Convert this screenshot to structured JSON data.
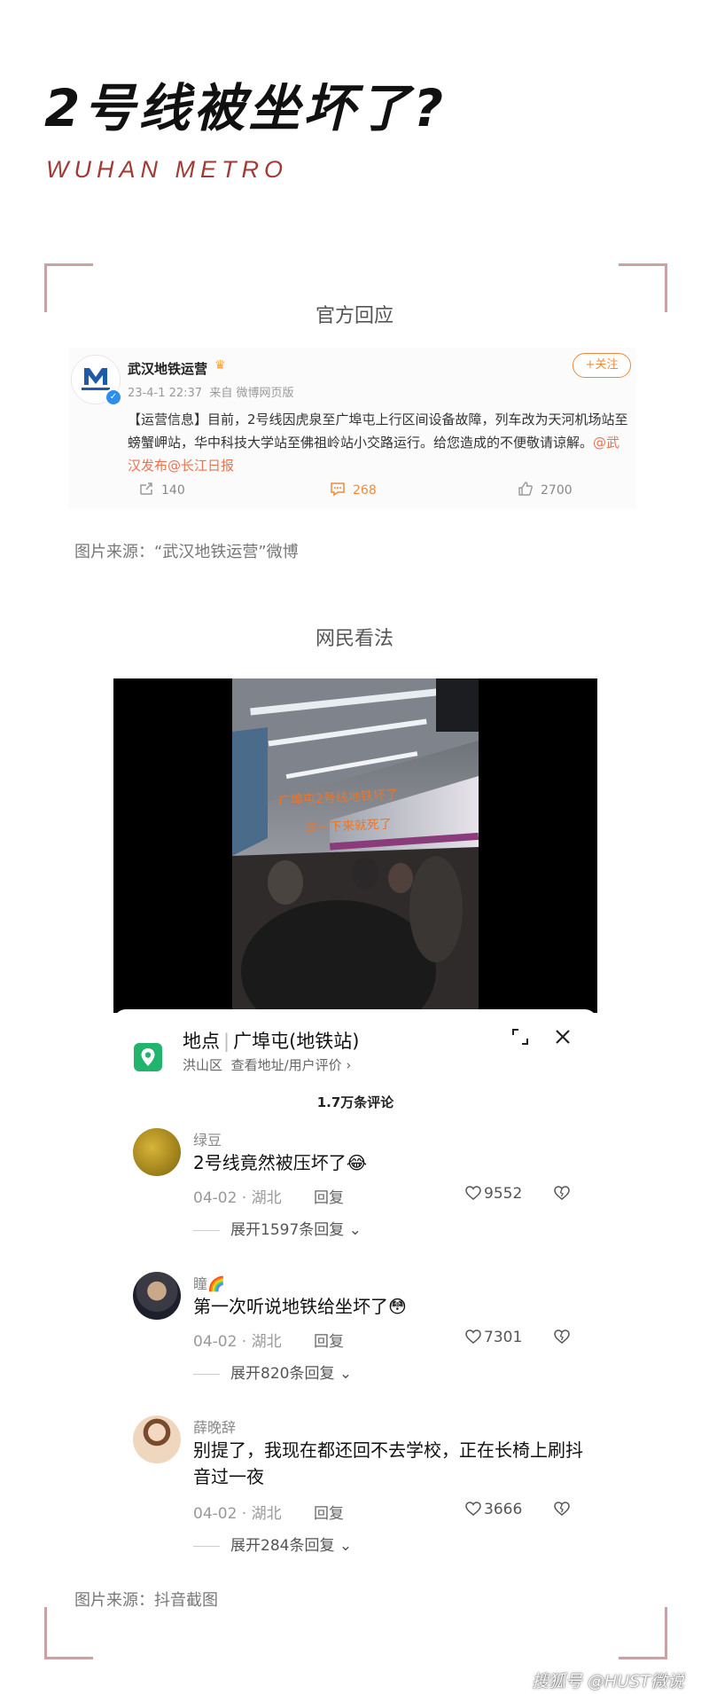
{
  "header": {
    "title": "2号线被坐坏了?",
    "subtitle": "WUHAN METRO"
  },
  "section1": {
    "heading": "官方回应"
  },
  "weibo": {
    "account_name": "武汉地铁运营",
    "time": "23-4-1 22:37",
    "source": "来自 微博网页版",
    "follow_label": "+关注",
    "text": "【运营信息】目前，2号线因虎泉至广埠屯上行区间设备故障，列车改为天河机场站至螃蟹岬站，华中科技大学站至佛祖岭站小交路运行。给您造成的不便敬请谅解。",
    "mentions": "@武汉发布@长江日报",
    "reposts": "140",
    "comments": "268",
    "likes": "2700",
    "logo_text": "武汉地铁运营"
  },
  "source1": "图片来源：“武汉地铁运营”微博",
  "section2": {
    "heading": "网民看法"
  },
  "video": {
    "overlay_line1": "广埠屯2号线地铁坏了",
    "overlay_line2": "车一下来就死了"
  },
  "panel": {
    "location_label": "地点",
    "location_name": "广埠屯(地铁站)",
    "district": "洪山区",
    "address_link": "查看地址/用户评价 ›",
    "comment_count": "1.7万条评论"
  },
  "comments": [
    {
      "name": "绿豆",
      "text": "2号线竟然被压坏了😂",
      "date": "04-02 · 湖北",
      "reply": "回复",
      "likes": "9552",
      "expand": "展开1597条回复"
    },
    {
      "name": "瞳🌈",
      "text": "第一次听说地铁给坐坏了😳",
      "date": "04-02 · 湖北",
      "reply": "回复",
      "likes": "7301",
      "expand": "展开820条回复"
    },
    {
      "name": "薛晚辞",
      "text": "别提了，我现在都还回不去学校，正在长椅上刷抖音过一夜",
      "date": "04-02 · 湖北",
      "reply": "回复",
      "likes": "3666",
      "expand": "展开284条回复"
    }
  ],
  "source2": "图片来源：抖音截图",
  "watermark": "搜狐号 @HUST微说",
  "colors": {
    "accent_red": "#a23a35",
    "corner": "#c9a3a3",
    "weibo_orange": "#f08a3a",
    "map_green": "#20b46c"
  }
}
